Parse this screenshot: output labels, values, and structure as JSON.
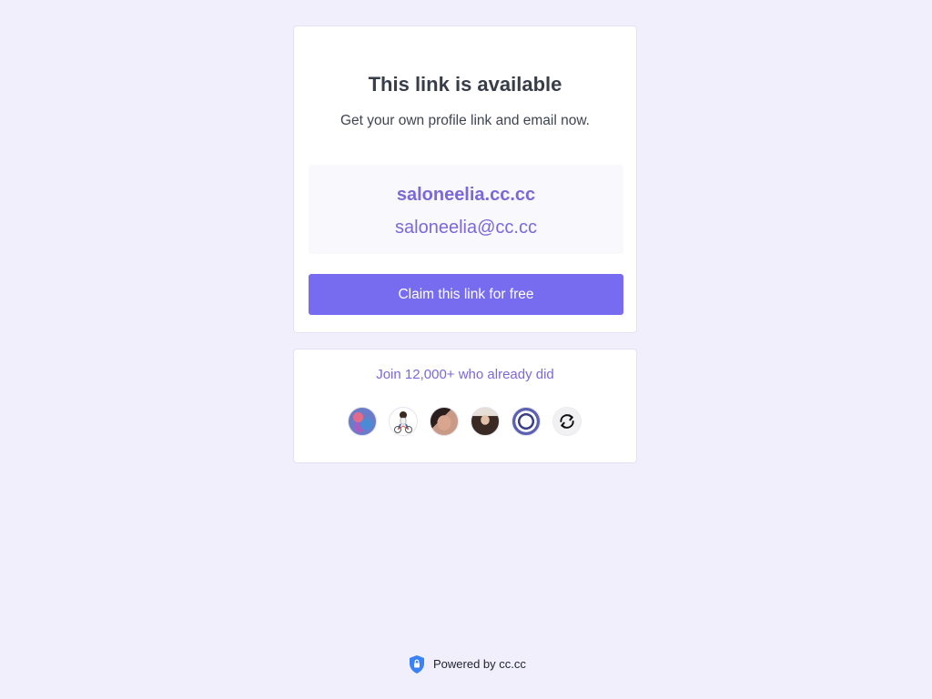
{
  "main_card": {
    "title": "This link is available",
    "subtitle": "Get your own profile link and email now.",
    "link_url": "saloneelia.cc.cc",
    "link_email": "saloneelia@cc.cc",
    "claim_button_label": "Claim this link for free"
  },
  "join_card": {
    "text": "Join 12,000+ who already did",
    "avatars": [
      {
        "name": "avatar-1"
      },
      {
        "name": "avatar-2"
      },
      {
        "name": "avatar-3"
      },
      {
        "name": "avatar-4"
      },
      {
        "name": "avatar-5"
      }
    ],
    "refresh_icon": "refresh-icon"
  },
  "footer": {
    "icon": "shield-icon",
    "text": "Powered by cc.cc"
  },
  "colors": {
    "background": "#f0effb",
    "accent": "#776cf0",
    "accent_text": "#7c68d9",
    "shield": "#3b82f6"
  }
}
